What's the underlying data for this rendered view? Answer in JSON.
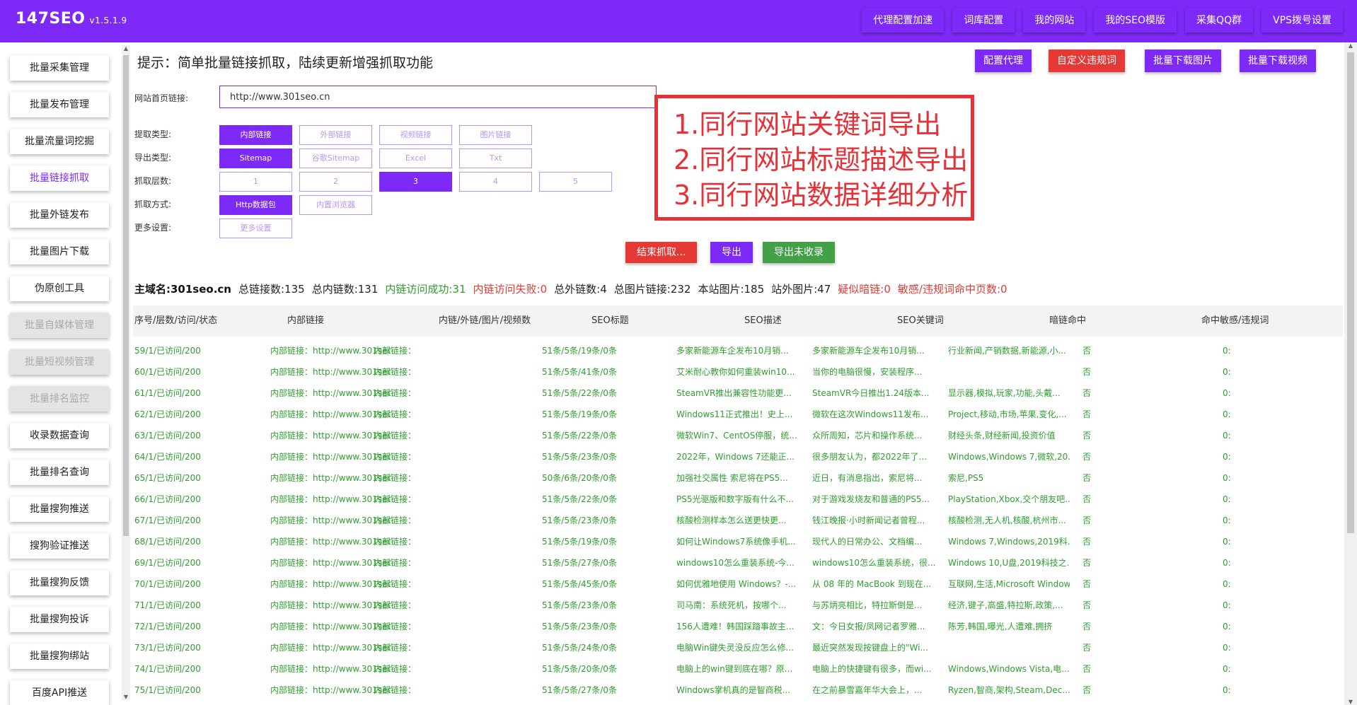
{
  "app": {
    "name": "147SEO",
    "version": "v1.5.1.9"
  },
  "topnav": [
    "代理配置加速",
    "词库配置",
    "我的网站",
    "我的SEO模版",
    "采集QQ群",
    "VPS拨号设置"
  ],
  "sidebar": [
    {
      "label": "批量采集管理",
      "state": "normal"
    },
    {
      "label": "批量发布管理",
      "state": "normal"
    },
    {
      "label": "批量流量词挖掘",
      "state": "normal"
    },
    {
      "label": "批量链接抓取",
      "state": "active"
    },
    {
      "label": "批量外链发布",
      "state": "normal"
    },
    {
      "label": "批量图片下载",
      "state": "normal"
    },
    {
      "label": "伪原创工具",
      "state": "normal"
    },
    {
      "label": "批量自媒体管理",
      "state": "disabled"
    },
    {
      "label": "批量短视频管理",
      "state": "disabled"
    },
    {
      "label": "批量排名监控",
      "state": "disabled"
    },
    {
      "label": "收录数据查询",
      "state": "normal"
    },
    {
      "label": "批量排名查询",
      "state": "normal"
    },
    {
      "label": "批量搜狗推送",
      "state": "normal"
    },
    {
      "label": "搜狗验证推送",
      "state": "normal"
    },
    {
      "label": "批量搜狗反馈",
      "state": "normal"
    },
    {
      "label": "批量搜狗投诉",
      "state": "normal"
    },
    {
      "label": "批量搜狗绑站",
      "state": "normal"
    },
    {
      "label": "百度API推送",
      "state": "normal"
    }
  ],
  "main": {
    "hint": "提示：简单批量链接抓取，陆续更新增强抓取功能",
    "toolbar": [
      {
        "label": "配置代理",
        "color": "#7d2af8"
      },
      {
        "label": "自定义违规词",
        "color": "#e53935"
      },
      {
        "label": "批量下载图片",
        "color": "#7d2af8"
      },
      {
        "label": "批量下载视频",
        "color": "#7d2af8"
      }
    ],
    "form": {
      "url_label": "网站首页链接:",
      "url_value": "http://www.301seo.cn",
      "extract_label": "提取类型:",
      "extract_options": [
        {
          "label": "内部链接",
          "selected": true
        },
        {
          "label": "外部链接",
          "selected": false
        },
        {
          "label": "视频链接",
          "selected": false
        },
        {
          "label": "图片链接",
          "selected": false
        }
      ],
      "export_label": "导出类型:",
      "export_options": [
        {
          "label": "Sitemap",
          "selected": true
        },
        {
          "label": "谷歌Sitemap",
          "selected": false
        },
        {
          "label": "Excel",
          "selected": false
        },
        {
          "label": "Txt",
          "selected": false
        }
      ],
      "depth_label": "抓取层数:",
      "depth_options": [
        {
          "label": "1",
          "selected": false
        },
        {
          "label": "2",
          "selected": false
        },
        {
          "label": "3",
          "selected": true
        },
        {
          "label": "4",
          "selected": false
        },
        {
          "label": "5",
          "selected": false
        }
      ],
      "method_label": "抓取方式:",
      "method_options": [
        {
          "label": "Http数据包",
          "selected": true
        },
        {
          "label": "内置浏览器",
          "selected": false
        }
      ],
      "more_label": "更多设置:",
      "more_button": "更多设置"
    },
    "annotation": [
      "1.同行网站关键词导出",
      "2.同行网站标题描述导出",
      "3.同行网站数据详细分析"
    ],
    "actions": [
      {
        "label": "结束抓取...",
        "color": "#e53935"
      },
      {
        "label": "导出",
        "color": "#7d2af8"
      },
      {
        "label": "导出未收录",
        "color": "#43a047"
      }
    ],
    "stats": [
      {
        "text": "主域名:301seo.cn",
        "color": "#111",
        "bold": true
      },
      {
        "text": "总链接数:135",
        "color": "#222"
      },
      {
        "text": "总内链数:131",
        "color": "#222"
      },
      {
        "text": "内链访问成功:31",
        "color": "#2e9e2e"
      },
      {
        "text": "内链访问失败:0",
        "color": "#e53935"
      },
      {
        "text": "总外链数:4",
        "color": "#222"
      },
      {
        "text": "总图片链接:232",
        "color": "#222"
      },
      {
        "text": "本站图片:185",
        "color": "#222"
      },
      {
        "text": "站外图片:47",
        "color": "#222"
      },
      {
        "text": "疑似暗链:0",
        "color": "#e53935"
      },
      {
        "text": "敏感/违规词命中页数:0",
        "color": "#e53935"
      }
    ],
    "table": {
      "headers": [
        "序号/层数/访问/状态",
        "内部链接",
        "内链/外链/图片/视频数",
        "SEO标题",
        "SEO描述",
        "SEO关键词",
        "暗链命中",
        "命中敏感/违规词"
      ],
      "rows": [
        [
          "59/1/已访问/200",
          "内部链接：http://www.301seo.cn/i",
          "内部链接：",
          "51条/5条/19条/0条",
          "多家新能源车企发布10月销...",
          "多家新能源车企发布10月销...",
          "行业新闻,产销数据,新能源,小...",
          "否",
          "0:"
        ],
        [
          "60/1/已访问/200",
          "内部链接：http://www.301seo.cn/i",
          "内部链接：",
          "51条/5条/41条/0条",
          "艾米耐心教你如何重装win10...",
          "当你的电脑很慢，安装程序...",
          "",
          "否",
          "0:"
        ],
        [
          "61/1/已访问/200",
          "内部链接：http://www.301seo.cn/i",
          "内部链接：",
          "51条/5条/22条/0条",
          "SteamVR推出兼容性功能更...",
          "SteamVR今日推出1.24版本...",
          "显示器,模拟,玩家,功能,头戴...",
          "否",
          "0:"
        ],
        [
          "62/1/已访问/200",
          "内部链接：http://www.301seo.cn/i",
          "内部链接：",
          "51条/5条/19条/0条",
          "Windows11正式推出！史上...",
          "微软在这次Windows11发布...",
          "Project,移动,市场,苹果,变化,...",
          "否",
          "0:"
        ],
        [
          "63/1/已访问/200",
          "内部链接：http://www.301seo.cn/i",
          "内部链接：",
          "51条/5条/22条/0条",
          "微软Win7、CentOS停服，统...",
          "众所周知，芯片和操作系统...",
          "财经头条,财经新闻,投资价值",
          "否",
          "0:"
        ],
        [
          "64/1/已访问/200",
          "内部链接：http://www.301seo.cn/i",
          "内部链接：",
          "51条/5条/23条/0条",
          "2022年，Windows 7还能正...",
          "很多朋友认为，都2022年了...",
          "Windows,Windows 7,微软,20...",
          "否",
          "0:"
        ],
        [
          "65/1/已访问/200",
          "内部链接：http://www.301seo.cn/i",
          "内部链接：",
          "50条/6条/20条/0条",
          "加强社交属性 索尼将在PS5...",
          "近日，有消息指出，索尼将...",
          "索尼,PS5",
          "否",
          "0:"
        ],
        [
          "66/1/已访问/200",
          "内部链接：http://www.301seo.cn/i",
          "内部链接：",
          "51条/5条/22条/0条",
          "PS5光驱版和数字版有什么不...",
          "对于游戏发烧友和普通的PS5...",
          "PlayStation,Xbox,交个朋友吧...",
          "否",
          "0:"
        ],
        [
          "67/1/已访问/200",
          "内部链接：http://www.301seo.cn/i",
          "内部链接：",
          "51条/5条/23条/0条",
          "核酸检测样本怎么送更快更...",
          "钱江晚报·小时新闻记者曾程...",
          "核酸检测,无人机,核酸,杭州市...",
          "否",
          "0:"
        ],
        [
          "68/1/已访问/200",
          "内部链接：http://www.301seo.cn/i",
          "内部链接：",
          "51条/5条/19条/0条",
          "如何让Windows7系统像手机...",
          "现代人的日常办公、文档编...",
          "Windows 7,Windows,2019科...",
          "否",
          "0:"
        ],
        [
          "69/1/已访问/200",
          "内部链接：http://www.301seo.cn/i",
          "内部链接：",
          "51条/5条/27条/0条",
          "windows10怎么重装系统-今...",
          "windows10怎么重装系统，很...",
          "Windows 10,U盘,2019科技之...",
          "否",
          "0:"
        ],
        [
          "70/1/已访问/200",
          "内部链接：http://www.301seo.cn/i",
          "内部链接：",
          "51条/5条/45条/0条",
          "如何优雅地使用 Windows？-...",
          "从 08 年的 MacBook 到现在...",
          "互联网,生活,Microsoft Windows",
          "否",
          "0:"
        ],
        [
          "71/1/已访问/200",
          "内部链接：http://www.301seo.cn/i",
          "内部链接：",
          "51条/5条/23条/0条",
          "司马南：系统死机，按哪个...",
          "与苏炳亮相比，特拉斯倒是...",
          "经济,键子,高盛,特拉斯,政策,...",
          "否",
          "0:"
        ],
        [
          "72/1/已访问/200",
          "内部链接：http://www.301seo.cn/i",
          "内部链接：",
          "51条/5条/23条/0条",
          "156人遭难！韩国踩踏事故主...",
          "文：今日女报/凤网记者罗雅...",
          "陈芳,韩国,曝光,人遭难,拥挤",
          "否",
          "0:"
        ],
        [
          "73/1/已访问/200",
          "内部链接：http://www.301seo.cn/i",
          "内部链接：",
          "51条/5条/24条/0条",
          "电脑Win键失灵没反应怎么修...",
          "最近突然发现按键盘上的\"Wi...",
          "",
          "否",
          "0:"
        ],
        [
          "74/1/已访问/200",
          "内部链接：http://www.301seo.cn/i",
          "内部链接：",
          "51条/5条/20条/0条",
          "电脑上的win键到底在哪？原...",
          "电脑上的快捷键有很多，而wi...",
          "Windows,Windows Vista,电...",
          "否",
          "0:"
        ],
        [
          "75/1/已访问/200",
          "内部链接：http://www.301seo.cn/i",
          "内部链接：",
          "51条/5条/27条/0条",
          "Windows掌机真的是智商税...",
          "在之前暴雪嘉年华大会上，...",
          "Ryzen,智商,架构,Steam,Dec...",
          "否",
          "0:"
        ]
      ]
    }
  }
}
